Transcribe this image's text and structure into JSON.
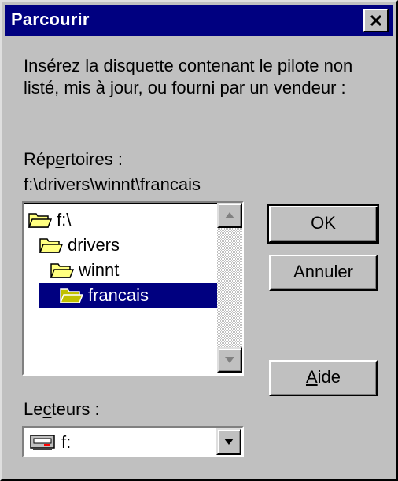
{
  "dialog": {
    "title": "Parcourir",
    "instruction_line1": "Insérez la disquette contenant le pilote non",
    "instruction_line2": "listé, mis à jour, ou fourni par un vendeur :"
  },
  "directories": {
    "label_pre": "Rép",
    "label_accel": "e",
    "label_post": "rtoires :",
    "current_path": "f:\\drivers\\winnt\\francais",
    "items": [
      {
        "label": "f:\\",
        "icon": "open-folder-icon",
        "selected": false
      },
      {
        "label": "drivers",
        "icon": "open-folder-icon",
        "selected": false
      },
      {
        "label": "winnt",
        "icon": "open-folder-icon",
        "selected": false
      },
      {
        "label": "francais",
        "icon": "open-folder-icon",
        "selected": true
      }
    ]
  },
  "drives": {
    "label_pre": "Le",
    "label_accel": "c",
    "label_post": "teurs :",
    "selected": "f:",
    "icon": "network-drive-icon"
  },
  "buttons": {
    "ok": "OK",
    "cancel": "Annuler",
    "help_accel": "A",
    "help_rest": "ide"
  },
  "colors": {
    "face": "#c0c0c0",
    "title_bar": "#000080",
    "selection": "#000080",
    "folder": "#ffff80"
  }
}
